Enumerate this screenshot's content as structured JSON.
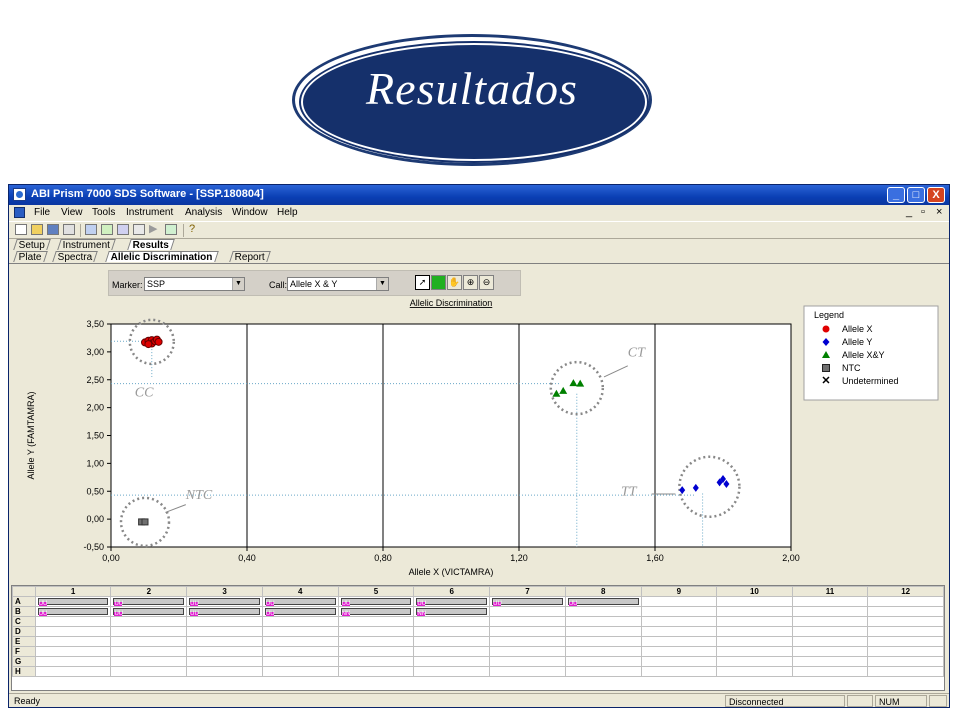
{
  "slide": {
    "title": "Resultados"
  },
  "window": {
    "title": "ABI Prism 7000 SDS Software - [SSP.180804]",
    "controls": {
      "minimize": "_",
      "maximize": "□",
      "close": "X"
    }
  },
  "menu": {
    "items": [
      "File",
      "View",
      "Tools",
      "Instrument",
      "Analysis",
      "Window",
      "Help"
    ],
    "mdi_controls": [
      "_",
      "▫",
      "×"
    ]
  },
  "tabs": {
    "main": [
      "Setup",
      "Instrument",
      "Results"
    ],
    "main_active": "Results",
    "sub": [
      "Plate",
      "Spectra",
      "Allelic Discrimination",
      "Report"
    ],
    "sub_active": "Allelic Discrimination"
  },
  "controls": {
    "marker_label": "Marker:",
    "marker_value": "SSP",
    "call_label": "Call:",
    "call_value": "Allele X & Y"
  },
  "chart_data": {
    "type": "scatter",
    "title": "Allelic Discrimination",
    "xlabel": "Allele X (VICTAMRA)",
    "ylabel": "Allele Y (FAMTAMRA)",
    "xlim": [
      0.0,
      2.0
    ],
    "ylim": [
      -0.5,
      3.5
    ],
    "x_ticks": [
      "0,00",
      "0,40",
      "0,80",
      "1,20",
      "1,60",
      "2,00"
    ],
    "y_ticks": [
      "3,50",
      "3,00",
      "2,50",
      "2,00",
      "1,50",
      "1,00",
      "0,50",
      "0,00",
      "-0,50"
    ],
    "series": [
      {
        "name": "Allele X",
        "color": "#e00000",
        "marker": "circle",
        "points": [
          [
            0.1,
            3.17
          ],
          [
            0.11,
            3.2
          ],
          [
            0.12,
            3.21
          ],
          [
            0.12,
            3.15
          ],
          [
            0.13,
            3.19
          ],
          [
            0.135,
            3.22
          ],
          [
            0.14,
            3.18
          ],
          [
            0.11,
            3.14
          ]
        ]
      },
      {
        "name": "Allele Y",
        "color": "#0000d0",
        "marker": "diamond",
        "points": [
          [
            1.68,
            0.52
          ],
          [
            1.72,
            0.56
          ],
          [
            1.79,
            0.66
          ],
          [
            1.8,
            0.72
          ],
          [
            1.81,
            0.63
          ]
        ]
      },
      {
        "name": "Allele X&Y",
        "color": "#008000",
        "marker": "triangle",
        "points": [
          [
            1.31,
            2.25
          ],
          [
            1.33,
            2.3
          ],
          [
            1.36,
            2.44
          ],
          [
            1.38,
            2.43
          ]
        ]
      },
      {
        "name": "NTC",
        "color": "#707070",
        "marker": "square",
        "points": [
          [
            0.09,
            -0.05
          ],
          [
            0.1,
            -0.05
          ]
        ]
      },
      {
        "name": "Undetermined",
        "color": "#000000",
        "marker": "x",
        "points": []
      }
    ],
    "annotations": [
      {
        "text": "CC",
        "x": 0.07,
        "y": 2.2
      },
      {
        "text": "CT",
        "x": 1.52,
        "y": 2.92
      },
      {
        "text": "TT",
        "x": 1.5,
        "y": 0.42
      },
      {
        "text": "NTC",
        "x": 0.22,
        "y": 0.36
      }
    ],
    "legend": {
      "title": "Legend",
      "position": "right"
    },
    "grid": true
  },
  "plate": {
    "columns": [
      "1",
      "2",
      "3",
      "4",
      "5",
      "6",
      "7",
      "8",
      "9",
      "10",
      "11",
      "12"
    ],
    "rows": [
      "A",
      "B",
      "C",
      "D",
      "E",
      "F",
      "G",
      "H"
    ],
    "wells": {
      "A": [
        "UU",
        "UU",
        "UU",
        "UU",
        "UU",
        "UU",
        "UU",
        "UU",
        "",
        "",
        "",
        ""
      ],
      "B": [
        "UU",
        "UU",
        "UU",
        "UU",
        "NN",
        "NN",
        "",
        "",
        "",
        "",
        "",
        ""
      ]
    }
  },
  "status": {
    "left": "Ready",
    "connection": "Disconnected",
    "num": "NUM"
  }
}
